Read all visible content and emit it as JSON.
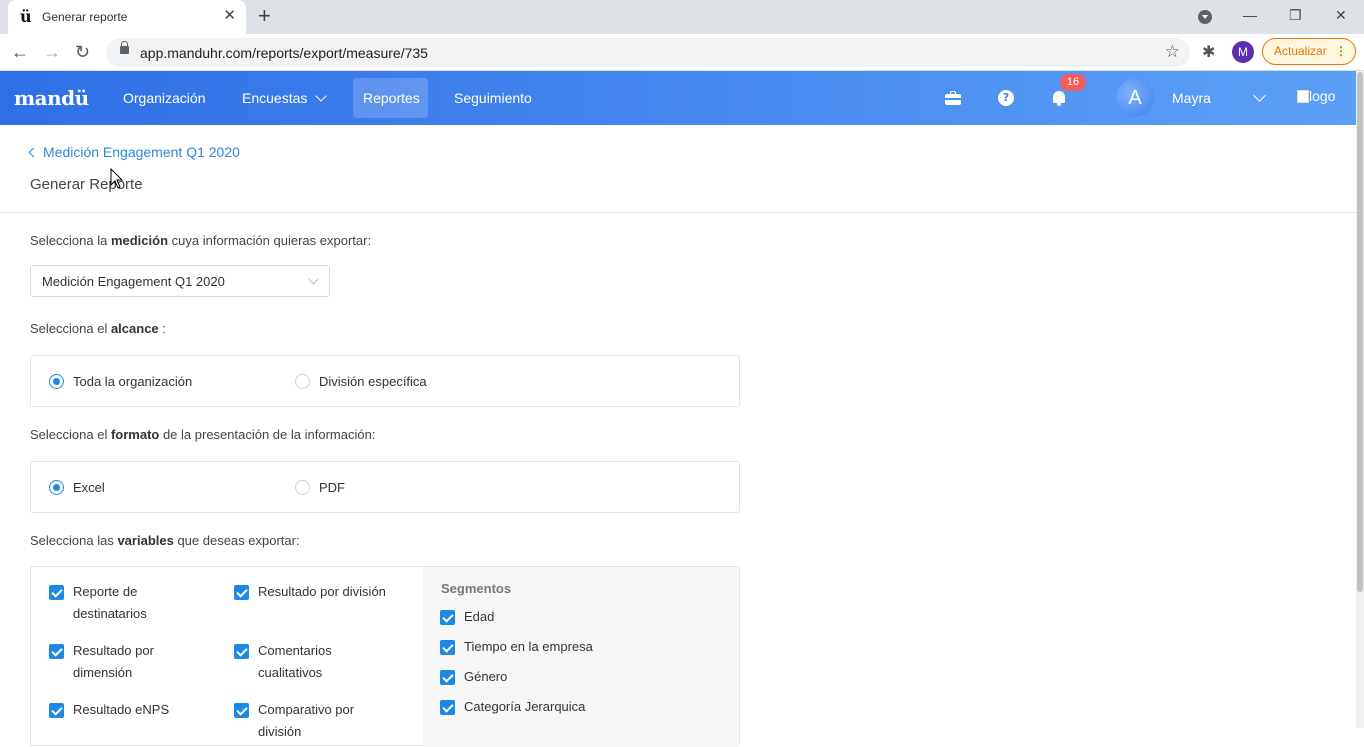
{
  "browser": {
    "tab_title": "Generar reporte",
    "favicon": "ü",
    "url": "app.manduhr.com/reports/export/measure/735",
    "profile_initial": "M",
    "update_label": "Actualizar"
  },
  "app": {
    "brand": "mandü",
    "nav": [
      {
        "label": "Organización"
      },
      {
        "label": "Encuestas"
      },
      {
        "label": "Reportes"
      },
      {
        "label": "Seguimiento"
      }
    ],
    "notifications_count": "16",
    "user_initial": "A",
    "user_name": "Mayra",
    "logo_alt": "logo"
  },
  "page": {
    "back_link": "Medición Engagement Q1 2020",
    "title": "Generar Reporte",
    "measure": {
      "label_pre": "Selecciona la ",
      "label_bold": "medición",
      "label_post": " cuya información quieras exportar:",
      "selected": "Medición Engagement Q1 2020"
    },
    "scope": {
      "label_pre": "Selecciona el ",
      "label_bold": "alcance",
      "label_post": " :",
      "options": [
        {
          "label": "Toda la organización",
          "selected": true
        },
        {
          "label": "División específica",
          "selected": false
        }
      ]
    },
    "format": {
      "label_pre": "Selecciona el ",
      "label_bold": "formato",
      "label_post": " de la presentación de la información:",
      "options": [
        {
          "label": "Excel",
          "selected": true
        },
        {
          "label": "PDF",
          "selected": false
        }
      ]
    },
    "variables": {
      "label_pre": "Selecciona las ",
      "label_bold": "variables",
      "label_post": " que deseas exportar:",
      "col1": [
        "Reporte de destinatarios",
        "Resultado por dimensión",
        "Resultado eNPS"
      ],
      "col2": [
        "Resultado por división",
        "Comentarios cualitativos",
        "Comparativo por división"
      ],
      "segments_title": "Segmentos",
      "segments": [
        "Edad",
        "Tiempo en la empresa",
        "Género",
        "Categoría Jerarquica"
      ]
    }
  },
  "colors": {
    "primary": "#1e88e5",
    "header_start": "#2f6fe6",
    "header_end": "#5ba0f5",
    "link": "#2e86de",
    "badge": "#f25c5c"
  }
}
